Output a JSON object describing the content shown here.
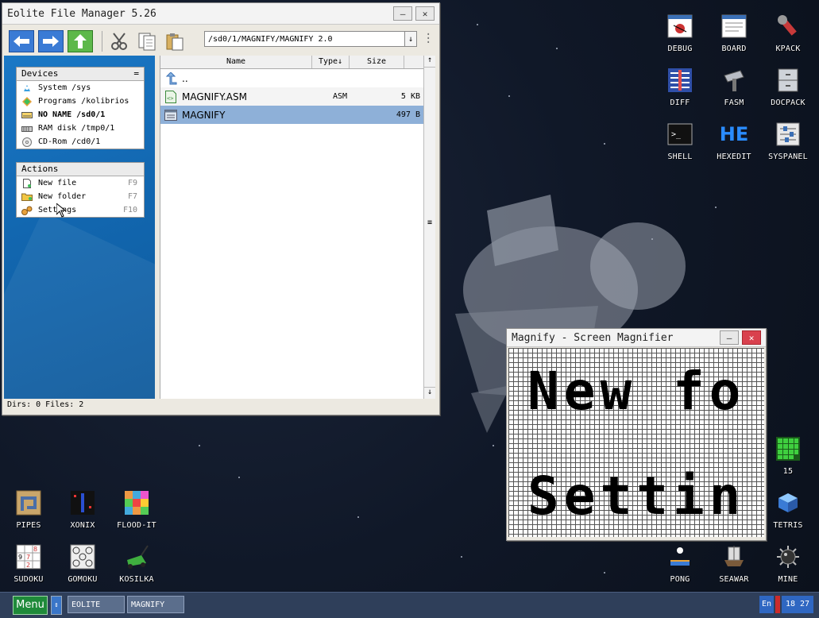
{
  "desktop": {
    "icons_right": [
      {
        "label": "DEBUG"
      },
      {
        "label": "BOARD"
      },
      {
        "label": "KPACK"
      },
      {
        "label": "DIFF"
      },
      {
        "label": "FASM"
      },
      {
        "label": "DOCPACK"
      },
      {
        "label": "SHELL"
      },
      {
        "label": "HEXEDIT"
      },
      {
        "label": "SYSPANEL"
      }
    ],
    "icons_bottom_left": [
      {
        "label": "PIPES"
      },
      {
        "label": "XONIX"
      },
      {
        "label": "FLOOD-IT"
      },
      {
        "label": "SUDOKU"
      },
      {
        "label": "GOMOKU"
      },
      {
        "label": "KOSILKA"
      }
    ],
    "icons_bottom_right": [
      {
        "label": "15"
      },
      {
        "label": "TETRIS"
      },
      {
        "label": "PONG"
      },
      {
        "label": "SEAWAR"
      },
      {
        "label": "MINE"
      }
    ],
    "hexedit_glyph": "HE"
  },
  "file_manager": {
    "title": "Eolite File Manager 5.26",
    "path": "/sd0/1/MAGNIFY/MAGNIFY 2.0",
    "devices": {
      "header": "Devices",
      "header_symbol": "=",
      "items": [
        {
          "label": "System /sys"
        },
        {
          "label": "Programs /kolibrios"
        },
        {
          "label": "NO NAME /sd0/1"
        },
        {
          "label": "RAM disk /tmp0/1"
        },
        {
          "label": "CD-Rom /cd0/1"
        }
      ]
    },
    "actions": {
      "header": "Actions",
      "items": [
        {
          "label": "New file",
          "key": "F9"
        },
        {
          "label": "New folder",
          "key": "F7"
        },
        {
          "label": "Settings",
          "key": "F10"
        }
      ]
    },
    "columns": {
      "name": "Name",
      "type": "Type↓",
      "size": "Size"
    },
    "files": [
      {
        "name": "..",
        "type": "",
        "size": ""
      },
      {
        "name": "MAGNIFY.ASM",
        "type": "ASM",
        "size": "5 KB"
      },
      {
        "name": "MAGNIFY",
        "type": "",
        "size": "497 B"
      }
    ],
    "status": "Dirs: 0   Files: 2"
  },
  "magnifier": {
    "title": "Magnify - Screen Magnifier",
    "line1": "New fo",
    "line2": "Settin"
  },
  "taskbar": {
    "menu_label": "Menu",
    "tasks": [
      {
        "label": "EOLITE"
      },
      {
        "label": "MAGNIFY"
      }
    ],
    "lang": "En",
    "clock": "18 27"
  }
}
